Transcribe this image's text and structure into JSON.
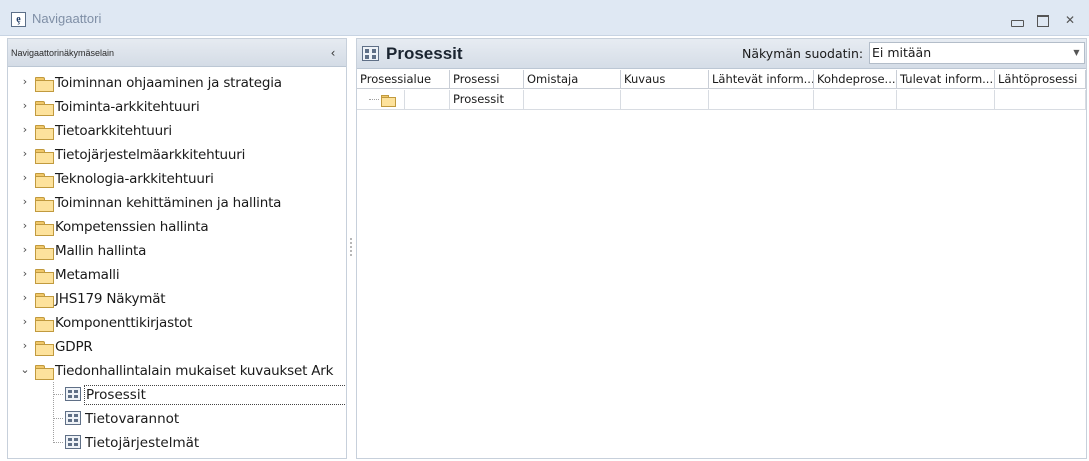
{
  "window": {
    "title": "Navigaattori",
    "app_icon_glyph": "ȩ",
    "controls": [
      "minimize-icon",
      "maximize-icon",
      "close-icon"
    ],
    "close_glyph": "✕"
  },
  "left_panel": {
    "header_label": "Navigaattorinäkymäselain",
    "collapse_glyph": "‹",
    "tree": [
      {
        "label": "Toiminnan ohjaaminen ja strategia",
        "expanded": false,
        "icon": "folder-icon"
      },
      {
        "label": "Toiminta-arkkitehtuuri",
        "expanded": false,
        "icon": "folder-icon"
      },
      {
        "label": "Tietoarkkitehtuuri",
        "expanded": false,
        "icon": "folder-icon"
      },
      {
        "label": "Tietojärjestelmäarkkitehtuuri",
        "expanded": false,
        "icon": "folder-icon"
      },
      {
        "label": "Teknologia-arkkitehtuuri",
        "expanded": false,
        "icon": "folder-icon"
      },
      {
        "label": "Toiminnan kehittäminen ja hallinta",
        "expanded": false,
        "icon": "folder-icon"
      },
      {
        "label": "Kompetenssien hallinta",
        "expanded": false,
        "icon": "folder-icon"
      },
      {
        "label": "Mallin hallinta",
        "expanded": false,
        "icon": "folder-icon"
      },
      {
        "label": "Metamalli",
        "expanded": false,
        "icon": "folder-icon"
      },
      {
        "label": "JHS179 Näkymät",
        "expanded": false,
        "icon": "folder-icon"
      },
      {
        "label": "Komponenttikirjastot",
        "expanded": false,
        "icon": "folder-icon"
      },
      {
        "label": "GDPR",
        "expanded": false,
        "icon": "folder-icon"
      },
      {
        "label": "Tiedonhallintalain mukaiset kuvaukset Ark",
        "expanded": true,
        "icon": "folder-icon"
      }
    ],
    "children": [
      {
        "label": "Prosessit",
        "selected": true,
        "icon": "grid-view-icon"
      },
      {
        "label": "Tietovarannot",
        "selected": false,
        "icon": "grid-view-icon"
      },
      {
        "label": "Tietojärjestelmät",
        "selected": false,
        "icon": "grid-view-icon"
      }
    ],
    "expander_collapsed_glyph": "›",
    "expander_expanded_glyph": "⌄"
  },
  "right_panel": {
    "title": "Prosessit",
    "title_icon": "grid-view-icon",
    "filter_label": "Näkymän suodatin:",
    "filter_value": "Ei mitään",
    "filter_arrow": "▼",
    "columns": [
      "Prosessialue",
      "Prosessi",
      "Omistaja",
      "Kuvaus",
      "Lähtevät inform...",
      "Kohdeprose...",
      "Tulevat inform...",
      "Lähtöprosessi"
    ],
    "rows": [
      {
        "prosessialue_icon": "folder-icon",
        "prosessi": "Prosessit",
        "omistaja": "",
        "kuvaus": "",
        "lahtevat": "",
        "kohdeprosessi": "",
        "tulevat": "",
        "lahtoprosessi": ""
      }
    ]
  },
  "colors": {
    "titlebar_bg": "#dfe8f3",
    "panel_border": "#c7d0db",
    "folder_fill": "#fde29c",
    "folder_edge": "#c19a3e"
  }
}
